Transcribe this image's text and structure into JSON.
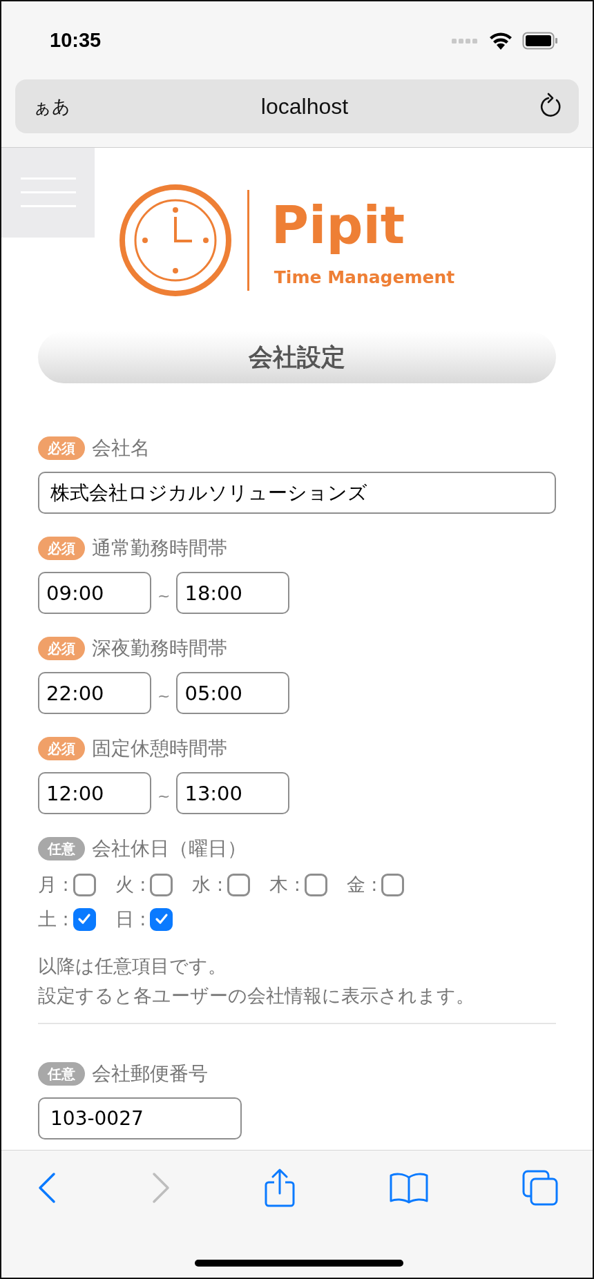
{
  "status_bar": {
    "time": "10:35"
  },
  "browser": {
    "text_size_button": "ぁあ",
    "address": "localhost"
  },
  "logo": {
    "name": "Pipit",
    "tagline": "Time Management"
  },
  "page_title": "会社設定",
  "fields": [
    {
      "kind": "text",
      "badge": "必須",
      "required": true,
      "label": "会社名",
      "value": "株式会社ロジカルソリューションズ"
    },
    {
      "kind": "time_range",
      "badge": "必須",
      "required": true,
      "label": "通常勤務時間帯",
      "from": "09:00",
      "separator": "~",
      "to": "18:00"
    },
    {
      "kind": "time_range",
      "badge": "必須",
      "required": true,
      "label": "深夜勤務時間帯",
      "from": "22:00",
      "separator": "~",
      "to": "05:00"
    },
    {
      "kind": "time_range",
      "badge": "必須",
      "required": true,
      "label": "固定休憩時間帯",
      "from": "12:00",
      "separator": "~",
      "to": "13:00"
    },
    {
      "kind": "weekdays",
      "badge": "任意",
      "required": false,
      "label": "会社休日（曜日）",
      "days": [
        {
          "label": "月 :",
          "checked": false
        },
        {
          "label": "火 :",
          "checked": false
        },
        {
          "label": "水 :",
          "checked": false
        },
        {
          "label": "木 :",
          "checked": false
        },
        {
          "label": "金 :",
          "checked": false
        },
        {
          "label": "土 :",
          "checked": true
        },
        {
          "label": "日 :",
          "checked": true
        }
      ]
    }
  ],
  "note": [
    "以降は任意項目です。",
    "設定すると各ユーザーの会社情報に表示されます。"
  ],
  "optional_fields": [
    {
      "kind": "short_text",
      "badge": "任意",
      "required": false,
      "label": "会社郵便番号",
      "value": "103-0027"
    }
  ],
  "toolbar": {
    "back_enabled": true,
    "forward_enabled": false
  }
}
